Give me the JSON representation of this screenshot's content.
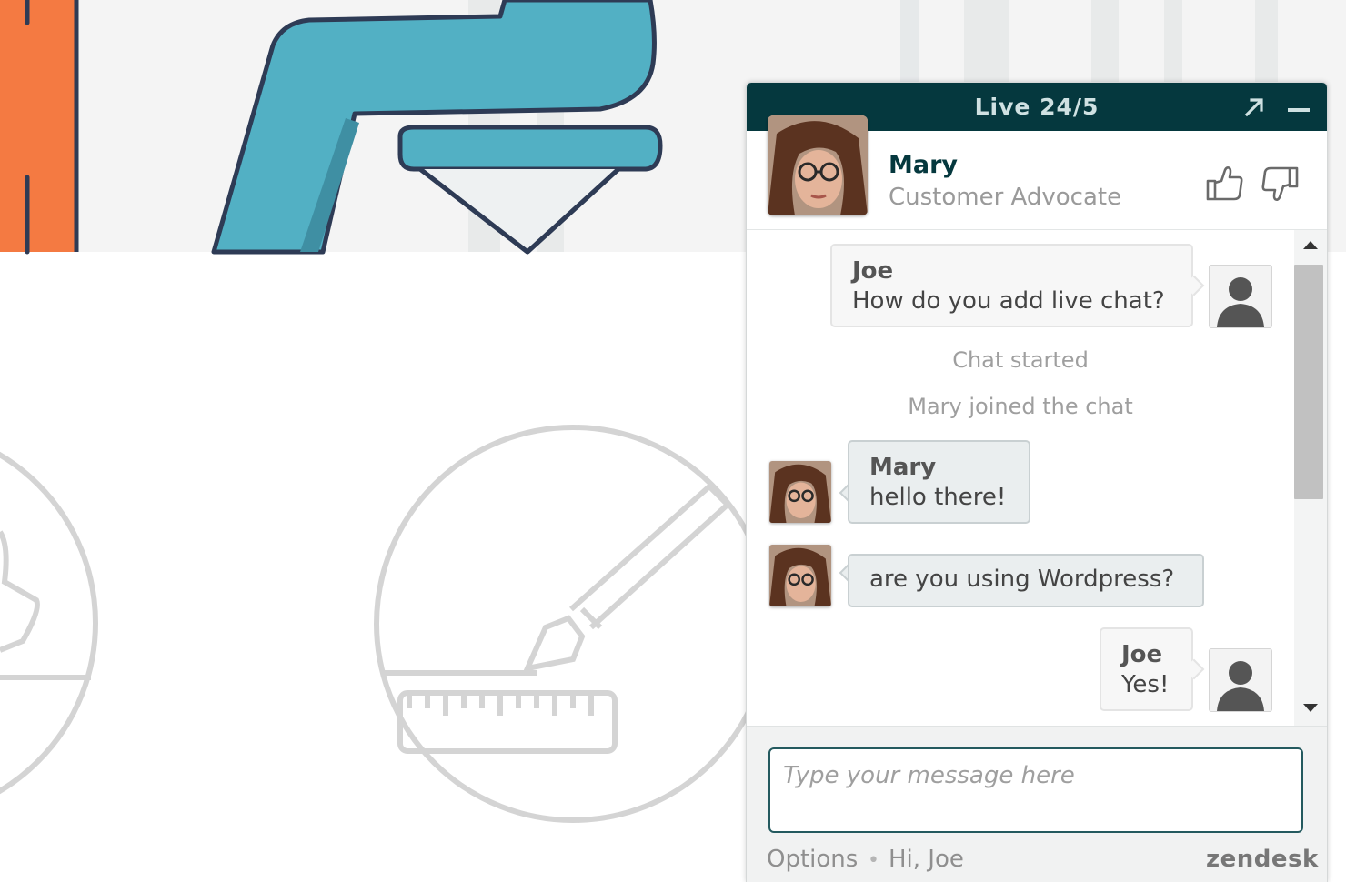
{
  "widget": {
    "title": "Live 24/5",
    "popout_icon": "popout-arrow-icon",
    "minimize_icon": "minimize-icon"
  },
  "agent": {
    "name": "Mary",
    "title": "Customer Advocate",
    "rate_up_icon": "thumbs-up-icon",
    "rate_down_icon": "thumbs-down-icon"
  },
  "messages": [
    {
      "type": "visitor",
      "sender": "Joe",
      "text": "How do you add live chat?"
    },
    {
      "type": "system",
      "text": "Chat started"
    },
    {
      "type": "system",
      "text": "Mary joined the chat"
    },
    {
      "type": "agent",
      "sender": "Mary",
      "text": "hello there!"
    },
    {
      "type": "agent",
      "sender": "",
      "text": "are you using Wordpress?"
    },
    {
      "type": "visitor",
      "sender": "Joe",
      "text": "Yes!"
    }
  ],
  "composer": {
    "placeholder": "Type your message here",
    "value": ""
  },
  "footer": {
    "options_label": "Options",
    "separator": "•",
    "greeting": "Hi, Joe",
    "brand": "zendesk"
  },
  "colors": {
    "header": "#05383e",
    "accent_border": "#245a5f",
    "hero_orange": "#f47a42",
    "hero_teal": "#52b0c4"
  }
}
